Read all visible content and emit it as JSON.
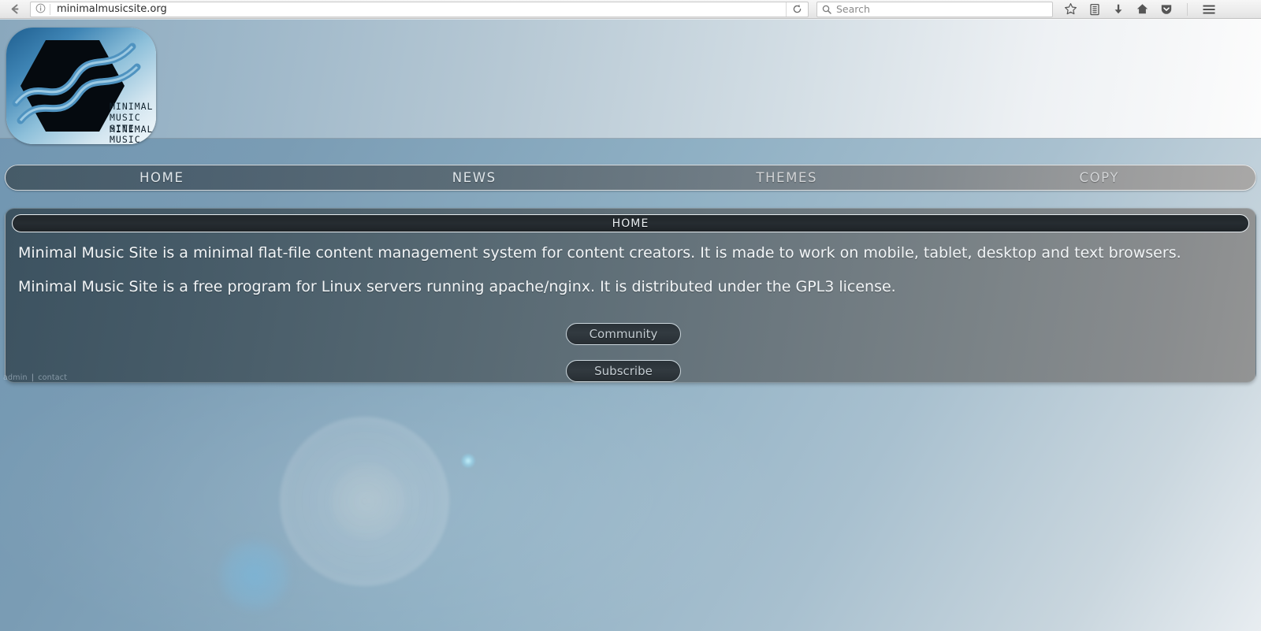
{
  "browser": {
    "back_icon": "back-arrow-icon",
    "identity_icon": "info-circle-icon",
    "url": "minimalmusicsite.org",
    "reload_icon": "reload-icon",
    "search_icon": "search-icon",
    "search_placeholder": "Search",
    "toolbar_icons": [
      {
        "name": "bookmark-star-icon",
        "glyph": "☆"
      },
      {
        "name": "library-icon",
        "glyph": "▤"
      },
      {
        "name": "downloads-icon",
        "glyph": "⬇"
      },
      {
        "name": "home-icon",
        "glyph": "⌂"
      },
      {
        "name": "pocket-icon",
        "glyph": "⮟"
      },
      {
        "name": "hamburger-menu-icon",
        "glyph": "☰"
      }
    ]
  },
  "site": {
    "logo": {
      "name": "minimal-music-site-logo",
      "line1": "MINIMAL",
      "line2": "MUSIC",
      "line3": "SITE"
    },
    "nav": [
      {
        "label": "HOME",
        "name": "nav-item-home"
      },
      {
        "label": "NEWS",
        "name": "nav-item-news"
      },
      {
        "label": "THEMES",
        "name": "nav-item-themes"
      },
      {
        "label": "COPY",
        "name": "nav-item-copy"
      }
    ],
    "panel": {
      "title": "HOME",
      "paragraph_1": "Minimal Music Site is a minimal flat-file content management system for content creators. It is made to work on mobile, tablet, desktop and text browsers.",
      "paragraph_2": "Minimal Music Site is a free program for Linux servers running apache/nginx. It is distributed under the GPL3 license.",
      "buttons": [
        {
          "label": "Community",
          "name": "community-button"
        },
        {
          "label": "Subscribe",
          "name": "subscribe-button"
        }
      ]
    },
    "footer": {
      "admin_label": "admin",
      "separator": "|",
      "contact_label": "contact"
    }
  },
  "colors": {
    "page_gradient_start": "#6f95b1",
    "page_gradient_end": "#e8edf1",
    "panel_dark": "#3c5260",
    "panel_light": "#939494",
    "title_bar": "#20262a",
    "nav_dark": "#465b68",
    "nav_light": "#a9a8a7",
    "text_light": "#f2f5f7"
  }
}
